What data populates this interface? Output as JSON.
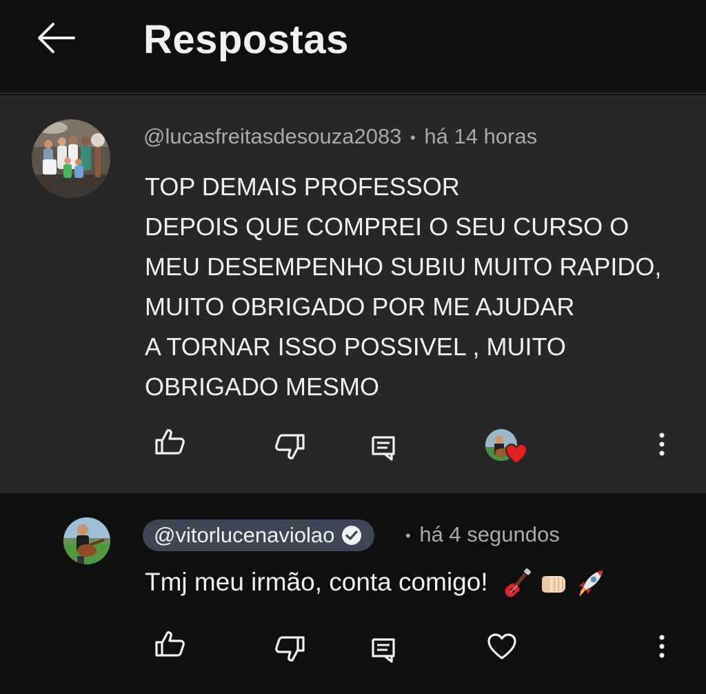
{
  "header": {
    "title": "Respostas",
    "back_icon": "arrow-left-icon"
  },
  "parent_comment": {
    "author": "@lucasfreitasdesouza2083",
    "separator": "•",
    "time": "há 14 horas",
    "text": "TOP DEMAIS PROFESSOR\nDEPOIS QUE COMPREI O SEU CURSO O\nMEU DESEMPENHO SUBIU MUITO RAPIDO,\nMUITO OBRIGADO POR ME AJUDAR\nA TORNAR ISSO POSSIVEL , MUITO\nOBRIGADO MESMO",
    "actions": [
      "like-icon",
      "dislike-icon",
      "reply-icon",
      "creator-heart",
      "more-icon"
    ]
  },
  "reply_comment": {
    "author": "@vitorlucenaviolao",
    "verified_icon": "verified-check-icon",
    "separator": "•",
    "time": "há 4 segundos",
    "text": "Tmj meu irmão, conta comigo!",
    "emojis": [
      "guitar-emoji",
      "fist-bump-emoji",
      "rocket-emoji"
    ],
    "actions": [
      "like-icon",
      "dislike-icon",
      "reply-icon",
      "heart-outline-icon",
      "more-icon"
    ]
  },
  "colors": {
    "background": "#0f0f0f",
    "parent_bg": "#272727",
    "chip_bg": "#3e4656",
    "meta_text": "#aaaaaa",
    "heart_red": "#e0201b"
  }
}
